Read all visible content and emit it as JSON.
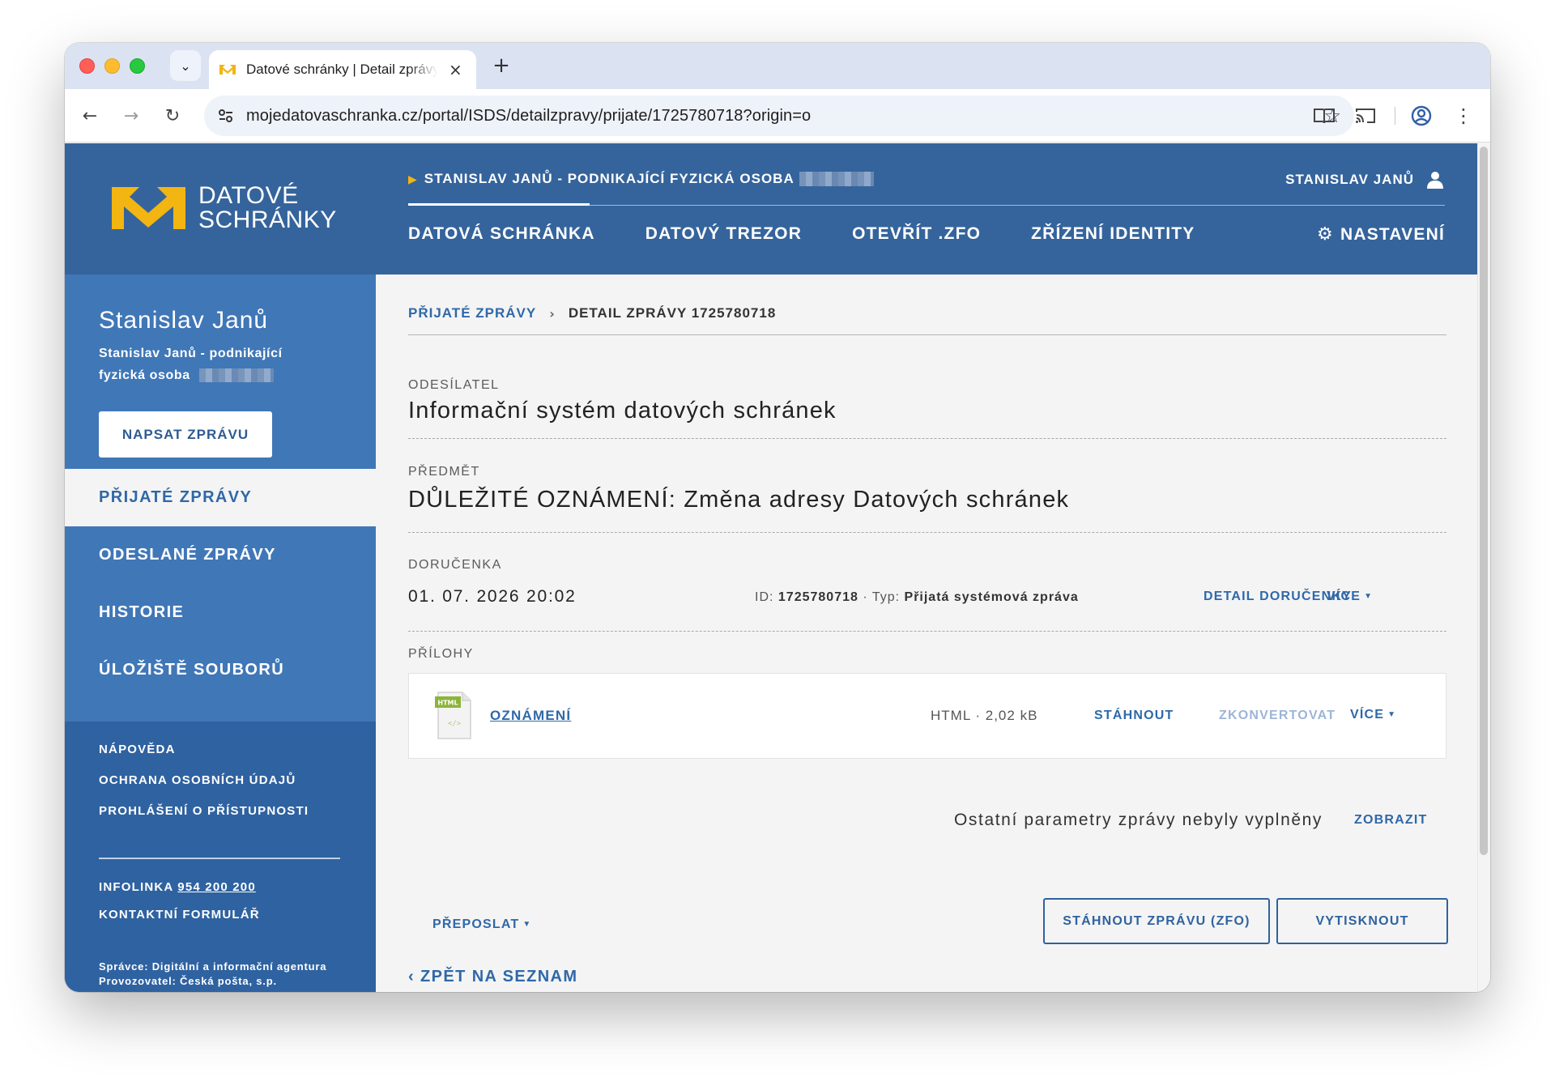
{
  "browser": {
    "tab_title": "Datové schránky | Detail zprávy",
    "url": "mojedatovaschranka.cz/portal/ISDS/detailzpravy/prijate/1725780718?origin=o"
  },
  "header": {
    "logo_line1": "DATOVÉ",
    "logo_line2": "SCHRÁNKY",
    "account": "STANISLAV JANŮ - PODNIKAJÍCÍ FYZICKÁ OSOBA",
    "user": "STANISLAV JANŮ",
    "nav": [
      "DATOVÁ SCHRÁNKA",
      "DATOVÝ TREZOR",
      "OTEVŘÍT .ZFO",
      "ZŘÍZENÍ IDENTITY"
    ],
    "settings": "NASTAVENÍ"
  },
  "sidebar": {
    "name": "Stanislav Janů",
    "subtitle": "Stanislav Janů - podnikající fyzická osoba",
    "compose": "NAPSAT ZPRÁVU",
    "menu": [
      "PŘIJATÉ ZPRÁVY",
      "ODESLANÉ ZPRÁVY",
      "HISTORIE",
      "ÚLOŽIŠTĚ SOUBORŮ"
    ],
    "help": "NÁPOVĚDA",
    "privacy": "OCHRANA OSOBNÍCH ÚDAJŮ",
    "accessibility": "PROHLÁŠENÍ O PŘÍSTUPNOSTI",
    "infoline_label": "INFOLINKA",
    "infoline_number": "954 200 200",
    "contact_form": "KONTAKTNÍ FORMULÁŘ",
    "footer_admin": "Správce: Digitální a informační agentura",
    "footer_operator": "Provozovatel: Česká pošta, s.p."
  },
  "breadcrumb": {
    "parent": "PŘIJATÉ ZPRÁVY",
    "current": "DETAIL ZPRÁVY 1725780718"
  },
  "message": {
    "sender_label": "ODESÍLATEL",
    "sender": "Informační systém datových schránek",
    "subject_label": "PŘEDMĚT",
    "subject": "DŮLEŽITÉ OZNÁMENÍ: Změna adresy Datových schránek",
    "receipt_label": "DORUČENKA",
    "receipt_date": "01. 07. 2026 20:02",
    "id_label": "ID:",
    "id_value": "1725780718",
    "type_label": "· Typ:",
    "type_value": "Přijatá systémová zpráva",
    "receipt_detail": "DETAIL DORUČENKY",
    "more": "VÍCE",
    "attachments_label": "PŘÍLOHY"
  },
  "attachment": {
    "icon_label": "HTML",
    "name": "OZNÁMENÍ",
    "meta": "HTML · 2,02 kB",
    "download": "STÁHNOUT",
    "convert": "ZKONVERTOVAT",
    "more": "VÍCE"
  },
  "other": {
    "params_text": "Ostatní parametry zprávy nebyly vyplněny",
    "show": "ZOBRAZIT"
  },
  "actions": {
    "forward": "PŘEPOSLAT",
    "download_zfo": "STÁHNOUT ZPRÁVU (ZFO)",
    "print": "VYTISKNOUT",
    "back": "ZPĚT NA SEZNAM"
  },
  "colors": {
    "header_blue": "#35649c",
    "sidebar_blue": "#4077b7",
    "accent_yellow": "#f2b511",
    "link_blue": "#2f68a8"
  },
  "icons": {
    "back": "arrow-left-icon",
    "forward": "arrow-right-icon",
    "reload": "reload-icon",
    "site_settings": "tune-icon",
    "bookmark": "star-icon",
    "reading_mode": "book-icon",
    "cast": "cast-icon",
    "profile": "account-circle-icon",
    "menu": "kebab-menu-icon",
    "user": "person-icon",
    "settings": "gear-icon"
  }
}
